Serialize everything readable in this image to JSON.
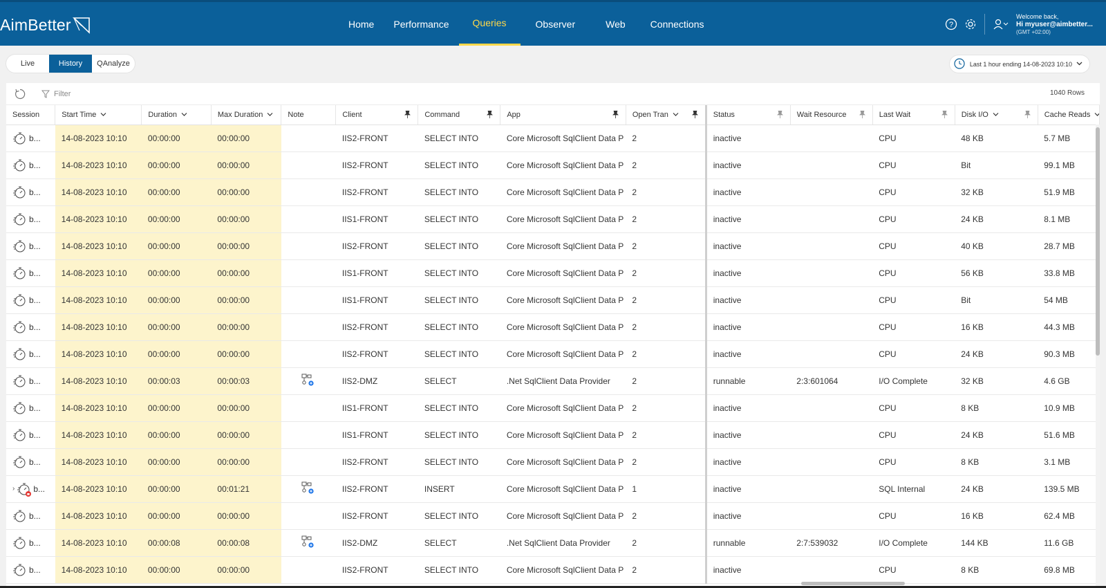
{
  "header": {
    "brand": "AimBetter",
    "nav": [
      "Home",
      "Performance",
      "Queries",
      "Observer",
      "Web",
      "Connections"
    ],
    "active_nav": "Queries",
    "welcome_line1": "Welcome back,",
    "welcome_line2": "Hi myuser@aimbetter...",
    "welcome_line3": "(GMT +02:00)"
  },
  "toolbar": {
    "tabs": [
      "Live",
      "History",
      "QAnalyze"
    ],
    "active_tab": "History",
    "time_range": "Last 1 hour ending  14-08-2023 10:10"
  },
  "grid": {
    "filter_placeholder": "Filter",
    "row_count": "1040 Rows",
    "columns": [
      "Session",
      "Start Time",
      "Duration",
      "Max Duration",
      "Note",
      "Client",
      "Command",
      "App",
      "Open Tran",
      "Status",
      "Wait Resource",
      "Last Wait",
      "Disk I/O",
      "Cache Reads"
    ],
    "rows": [
      {
        "session": "b...",
        "start": "14-08-2023 10:10",
        "duration": "00:00:00",
        "max": "00:00:00",
        "note": false,
        "client": "IIS2-FRONT",
        "command": "SELECT INTO",
        "app": "Core Microsoft SqlClient Data P",
        "open": "2",
        "status": "inactive",
        "wait_res": "",
        "last_wait": "CPU",
        "disk": "48 KB",
        "cache": "5.7 MB"
      },
      {
        "session": "b...",
        "start": "14-08-2023 10:10",
        "duration": "00:00:00",
        "max": "00:00:00",
        "note": false,
        "client": "IIS2-FRONT",
        "command": "SELECT INTO",
        "app": "Core Microsoft SqlClient Data P",
        "open": "2",
        "status": "inactive",
        "wait_res": "",
        "last_wait": "CPU",
        "disk": "Bit",
        "cache": "99.1 MB"
      },
      {
        "session": "b...",
        "start": "14-08-2023 10:10",
        "duration": "00:00:00",
        "max": "00:00:00",
        "note": false,
        "client": "IIS2-FRONT",
        "command": "SELECT INTO",
        "app": "Core Microsoft SqlClient Data P",
        "open": "2",
        "status": "inactive",
        "wait_res": "",
        "last_wait": "CPU",
        "disk": "32 KB",
        "cache": "51.9 MB"
      },
      {
        "session": "b...",
        "start": "14-08-2023 10:10",
        "duration": "00:00:00",
        "max": "00:00:00",
        "note": false,
        "client": "IIS1-FRONT",
        "command": "SELECT INTO",
        "app": "Core Microsoft SqlClient Data P",
        "open": "2",
        "status": "inactive",
        "wait_res": "",
        "last_wait": "CPU",
        "disk": "24 KB",
        "cache": "8.1 MB"
      },
      {
        "session": "b...",
        "start": "14-08-2023 10:10",
        "duration": "00:00:00",
        "max": "00:00:00",
        "note": false,
        "client": "IIS2-FRONT",
        "command": "SELECT INTO",
        "app": "Core Microsoft SqlClient Data P",
        "open": "2",
        "status": "inactive",
        "wait_res": "",
        "last_wait": "CPU",
        "disk": "40 KB",
        "cache": "28.7 MB"
      },
      {
        "session": "b...",
        "start": "14-08-2023 10:10",
        "duration": "00:00:00",
        "max": "00:00:00",
        "note": false,
        "client": "IIS1-FRONT",
        "command": "SELECT INTO",
        "app": "Core Microsoft SqlClient Data P",
        "open": "2",
        "status": "inactive",
        "wait_res": "",
        "last_wait": "CPU",
        "disk": "56 KB",
        "cache": "33.8 MB"
      },
      {
        "session": "b...",
        "start": "14-08-2023 10:10",
        "duration": "00:00:00",
        "max": "00:00:00",
        "note": false,
        "client": "IIS1-FRONT",
        "command": "SELECT INTO",
        "app": "Core Microsoft SqlClient Data P",
        "open": "2",
        "status": "inactive",
        "wait_res": "",
        "last_wait": "CPU",
        "disk": "Bit",
        "cache": "54 MB"
      },
      {
        "session": "b...",
        "start": "14-08-2023 10:10",
        "duration": "00:00:00",
        "max": "00:00:00",
        "note": false,
        "client": "IIS2-FRONT",
        "command": "SELECT INTO",
        "app": "Core Microsoft SqlClient Data P",
        "open": "2",
        "status": "inactive",
        "wait_res": "",
        "last_wait": "CPU",
        "disk": "16 KB",
        "cache": "44.3 MB"
      },
      {
        "session": "b...",
        "start": "14-08-2023 10:10",
        "duration": "00:00:00",
        "max": "00:00:00",
        "note": false,
        "client": "IIS2-FRONT",
        "command": "SELECT INTO",
        "app": "Core Microsoft SqlClient Data P",
        "open": "2",
        "status": "inactive",
        "wait_res": "",
        "last_wait": "CPU",
        "disk": "24 KB",
        "cache": "90.3 MB"
      },
      {
        "session": "b...",
        "start": "14-08-2023 10:10",
        "duration": "00:00:03",
        "max": "00:00:03",
        "note": true,
        "client": "IIS2-DMZ",
        "command": "SELECT",
        "app": ".Net SqlClient Data Provider",
        "open": "2",
        "status": "runnable",
        "wait_res": "2:3:601064",
        "last_wait": "I/O Complete",
        "disk": "32 KB",
        "cache": "4.6 GB"
      },
      {
        "session": "b...",
        "start": "14-08-2023 10:10",
        "duration": "00:00:00",
        "max": "00:00:00",
        "note": false,
        "client": "IIS1-FRONT",
        "command": "SELECT INTO",
        "app": "Core Microsoft SqlClient Data P",
        "open": "2",
        "status": "inactive",
        "wait_res": "",
        "last_wait": "CPU",
        "disk": "8 KB",
        "cache": "10.9 MB"
      },
      {
        "session": "b...",
        "start": "14-08-2023 10:10",
        "duration": "00:00:00",
        "max": "00:00:00",
        "note": false,
        "client": "IIS1-FRONT",
        "command": "SELECT INTO",
        "app": "Core Microsoft SqlClient Data P",
        "open": "2",
        "status": "inactive",
        "wait_res": "",
        "last_wait": "CPU",
        "disk": "24 KB",
        "cache": "51.6 MB"
      },
      {
        "session": "b...",
        "start": "14-08-2023 10:10",
        "duration": "00:00:00",
        "max": "00:00:00",
        "note": false,
        "client": "IIS2-FRONT",
        "command": "SELECT INTO",
        "app": "Core Microsoft SqlClient Data P",
        "open": "2",
        "status": "inactive",
        "wait_res": "",
        "last_wait": "CPU",
        "disk": "8 KB",
        "cache": "3.1 MB"
      },
      {
        "session": "b...",
        "start": "14-08-2023 10:10",
        "duration": "00:00:00",
        "max": "00:01:21",
        "note": true,
        "client": "IIS2-FRONT",
        "command": "INSERT",
        "app": "Core Microsoft SqlClient Data P",
        "open": "1",
        "status": "inactive",
        "wait_res": "",
        "last_wait": "SQL Internal",
        "disk": "24 KB",
        "cache": "139.5 MB",
        "expandable": true,
        "blocked": true
      },
      {
        "session": "b...",
        "start": "14-08-2023 10:10",
        "duration": "00:00:00",
        "max": "00:00:00",
        "note": false,
        "client": "IIS2-FRONT",
        "command": "SELECT INTO",
        "app": "Core Microsoft SqlClient Data P",
        "open": "2",
        "status": "inactive",
        "wait_res": "",
        "last_wait": "CPU",
        "disk": "16 KB",
        "cache": "62.4 MB"
      },
      {
        "session": "b...",
        "start": "14-08-2023 10:10",
        "duration": "00:00:08",
        "max": "00:00:08",
        "note": true,
        "client": "IIS2-DMZ",
        "command": "SELECT",
        "app": ".Net SqlClient Data Provider",
        "open": "2",
        "status": "runnable",
        "wait_res": "2:7:539032",
        "last_wait": "I/O Complete",
        "disk": "144 KB",
        "cache": "11.6 GB"
      },
      {
        "session": "b...",
        "start": "14-08-2023 10:10",
        "duration": "00:00:00",
        "max": "00:00:00",
        "note": false,
        "client": "IIS2-FRONT",
        "command": "SELECT INTO",
        "app": "Core Microsoft SqlClient Data P",
        "open": "2",
        "status": "inactive",
        "wait_res": "",
        "last_wait": "CPU",
        "disk": "8 KB",
        "cache": "69.8 MB"
      }
    ]
  },
  "colors": {
    "header_bg": "#0b609a",
    "nav_active": "#ffd84a",
    "highlight_col": "#fdf4cc",
    "note_icon": "#1a73e8"
  }
}
